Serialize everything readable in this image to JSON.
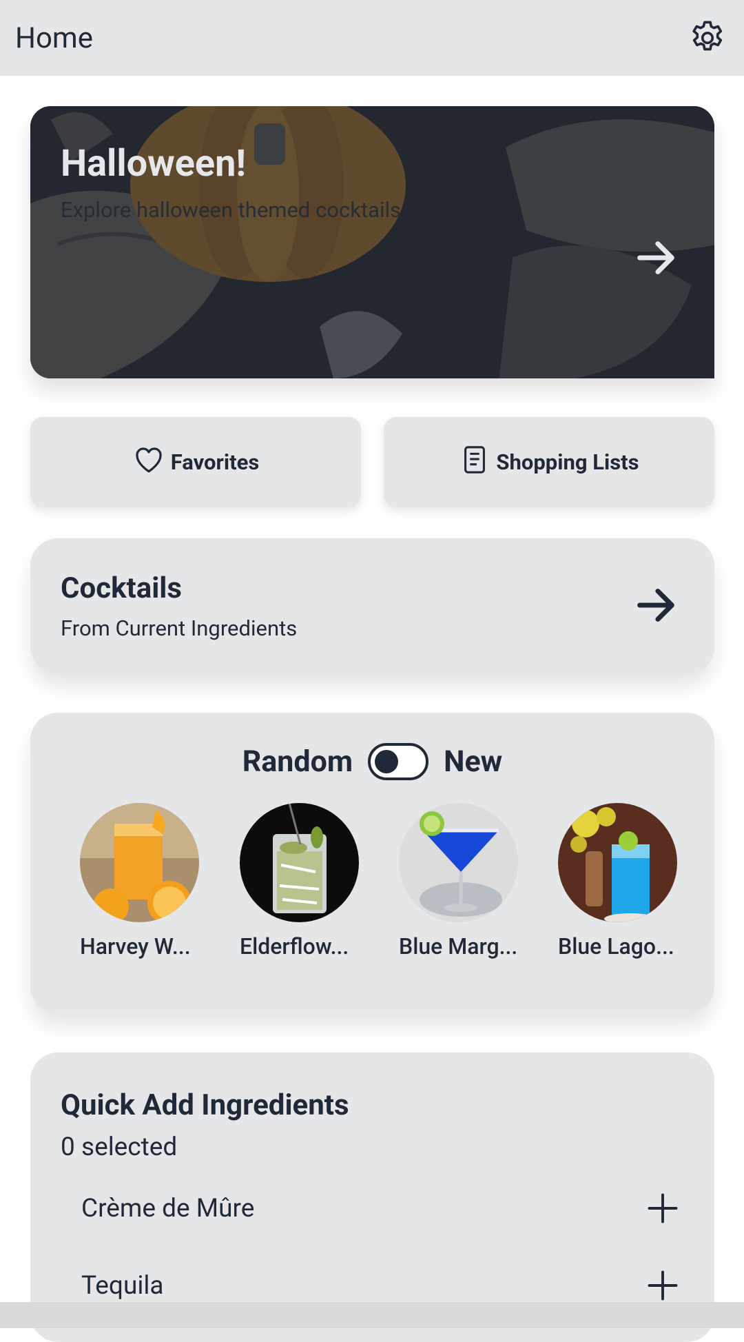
{
  "header": {
    "title": "Home"
  },
  "hero": {
    "title": "Halloween!",
    "subtitle": "Explore halloween themed cocktails"
  },
  "buttons": {
    "favorites": "Favorites",
    "shopping_lists": "Shopping Lists"
  },
  "cocktails": {
    "title": "Cocktails",
    "subtitle": "From Current Ingredients"
  },
  "discover": {
    "left_label": "Random",
    "right_label": "New",
    "toggle_state": "Random",
    "drinks": [
      {
        "name": "Harvey W..."
      },
      {
        "name": "Elderflow..."
      },
      {
        "name": "Blue Marg..."
      },
      {
        "name": "Blue Lago..."
      }
    ]
  },
  "quick_add": {
    "title": "Quick Add Ingredients",
    "selected_count": "0 selected",
    "ingredients": [
      {
        "name": "Crème de Mûre"
      },
      {
        "name": "Tequila"
      }
    ]
  },
  "colors": {
    "text": "#1f2937",
    "card": "#e5e6e7",
    "header": "#e5e6e7"
  },
  "icons": [
    "gear-icon",
    "arrow-right-icon",
    "heart-icon",
    "document-icon",
    "plus-icon"
  ]
}
